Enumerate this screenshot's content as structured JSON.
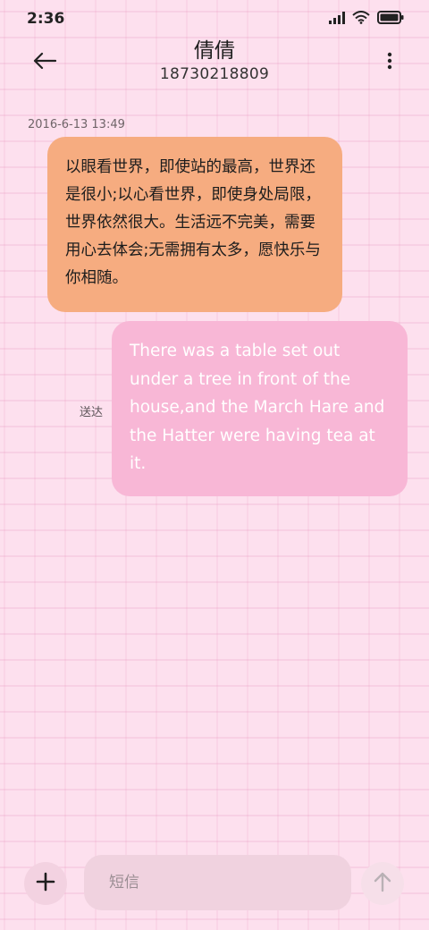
{
  "status_bar": {
    "time": "2:36",
    "icons": [
      "signal-icon",
      "wifi-icon",
      "battery-icon"
    ]
  },
  "header": {
    "contact_name": "倩倩",
    "phone_number": "18730218809",
    "icons": [
      "back-arrow-icon",
      "more-vert-icon"
    ]
  },
  "conversation": {
    "timestamp": "2016-6-13 13:49",
    "messages": [
      {
        "direction": "incoming",
        "text": "以眼看世界，即使站的最高，世界还是很小;以心看世界，即使身处局限，世界依然很大。生活远不完美，需要用心去体会;无需拥有太多，愿快乐与你相随。"
      },
      {
        "direction": "outgoing",
        "text": "There was a table set out under a tree in front of the house,and the March Hare and the Hatter were having tea at it.",
        "status": "送达"
      }
    ]
  },
  "composer": {
    "placeholder": "短信",
    "value": "",
    "icons": [
      "plus-icon",
      "send-arrow-icon"
    ]
  },
  "colors": {
    "background": "#fde0ee",
    "incoming_bubble": "#f6ac80",
    "outgoing_bubble": "#f8b7d6",
    "outgoing_text": "#ffffff"
  }
}
